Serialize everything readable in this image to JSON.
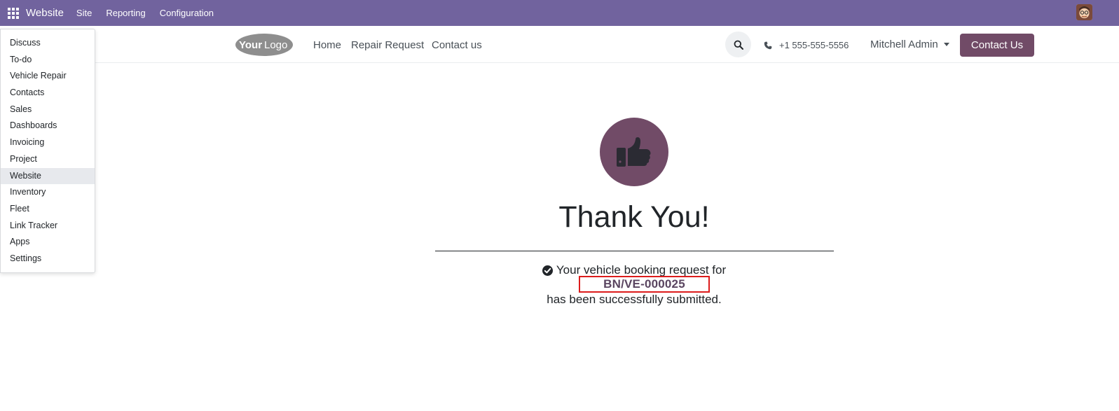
{
  "topbar": {
    "brand": "Website",
    "menus": [
      "Site",
      "Reporting",
      "Configuration"
    ]
  },
  "apps_menu": {
    "items": [
      "Discuss",
      "To-do",
      "Vehicle Repair",
      "Contacts",
      "Sales",
      "Dashboards",
      "Invoicing",
      "Project",
      "Website",
      "Inventory",
      "Fleet",
      "Link Tracker",
      "Apps",
      "Settings"
    ],
    "active": "Website"
  },
  "header": {
    "logo_text": "YourLogo",
    "nav": [
      "Home",
      "Repair Request",
      "Contact us"
    ],
    "phone": "+1 555-555-5556",
    "user": "Mitchell Admin",
    "contact_button": "Contact Us"
  },
  "main": {
    "title": "Thank You!",
    "line1": "Your vehicle booking request for",
    "reference": "BN/VE-000025",
    "line3": "has been successfully submitted."
  },
  "colors": {
    "topbar": "#71639e",
    "primary": "#714b67",
    "highlight_border": "#dc1c1c"
  }
}
